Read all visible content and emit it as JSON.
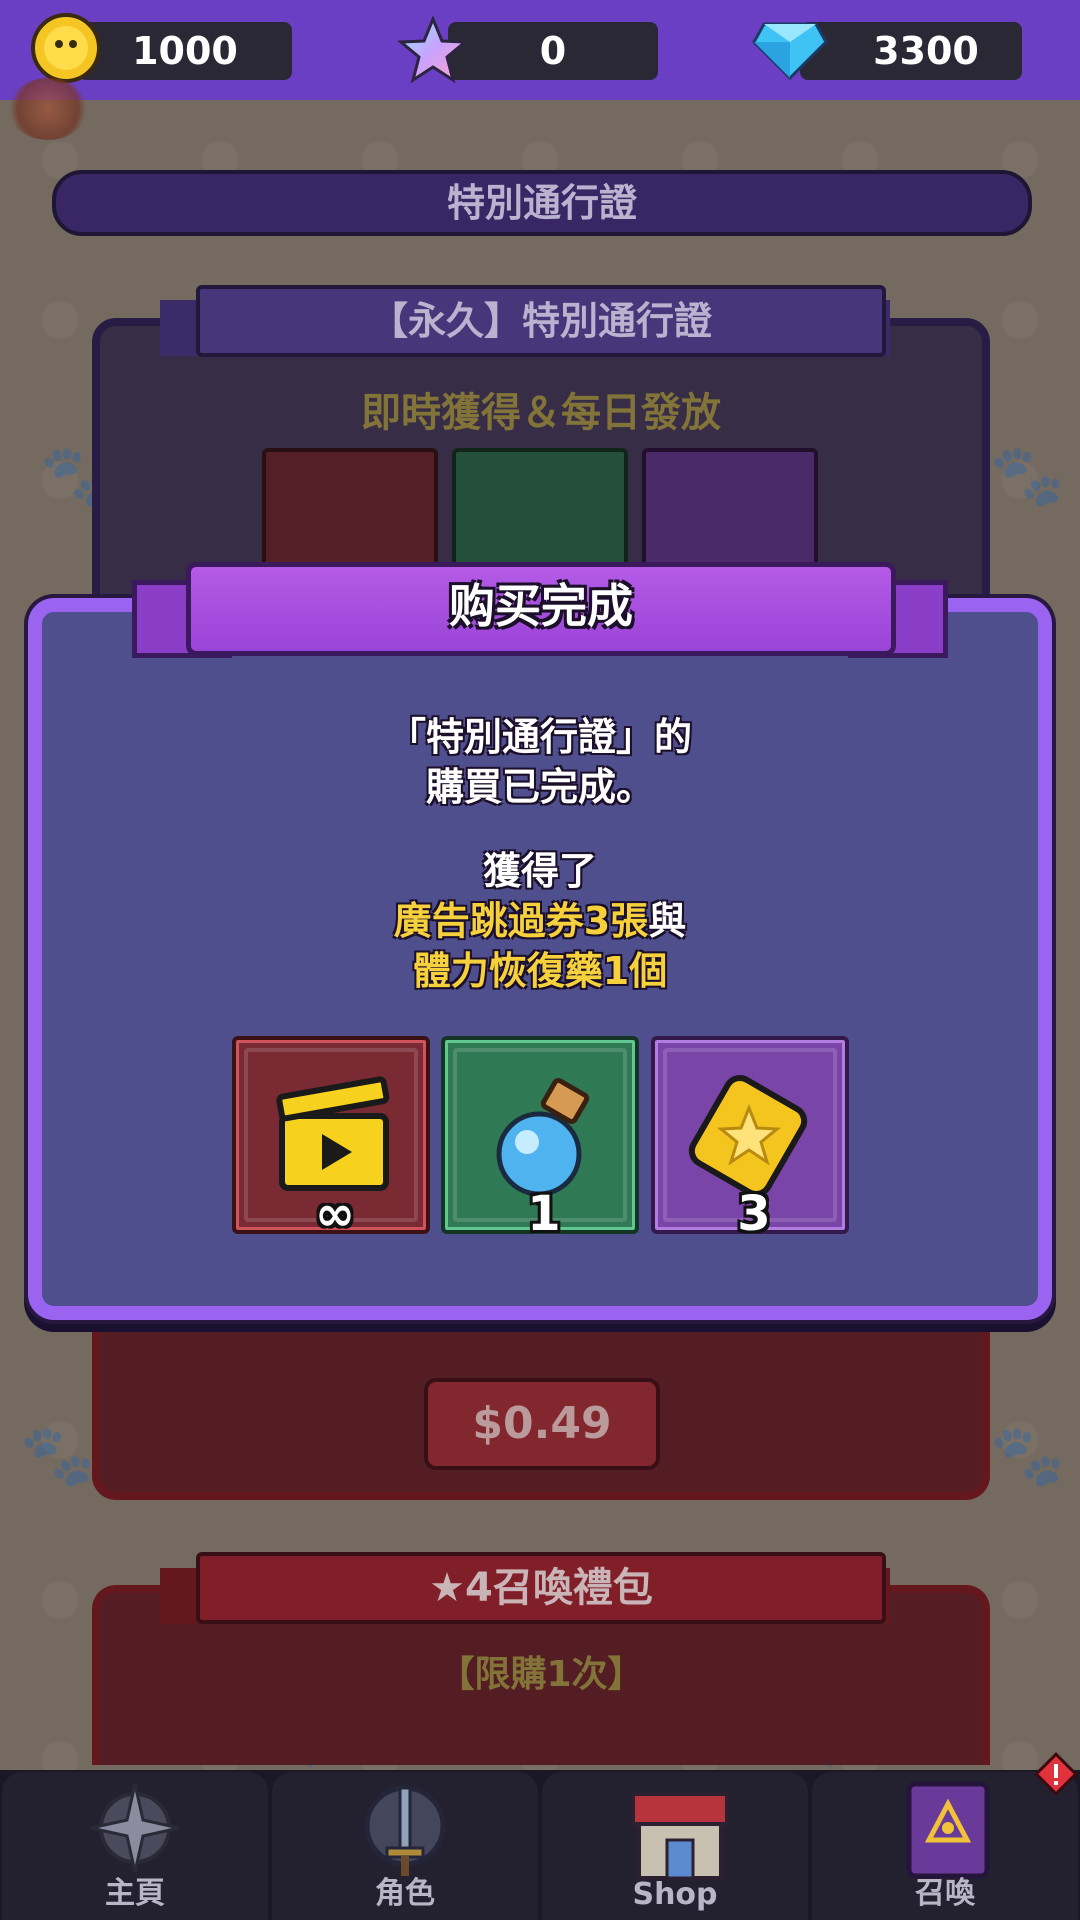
{
  "resources": {
    "coins": "1000",
    "stars": "0",
    "gems": "3300"
  },
  "shop": {
    "section_title": "特別通行證",
    "pass_card": {
      "title": "【永久】特別通行證",
      "subtitle": "即時獲得＆每日發放",
      "price": "$0.49"
    },
    "summon_card": {
      "title": "★4召喚禮包",
      "subtitle": "【限購1次】"
    }
  },
  "modal": {
    "title": "购买完成",
    "line1": "「特別通行證」的",
    "line2": "購買已完成。",
    "line3": "獲得了",
    "line4_highlight": "廣告跳過券3張",
    "line4_suffix": "與",
    "line5_highlight": "體力恢復藥1個",
    "rewards": [
      {
        "icon": "clapperboard-icon",
        "count": "∞",
        "color": "#7a2a33"
      },
      {
        "icon": "potion-icon",
        "count": "1",
        "color": "#2f7a55"
      },
      {
        "icon": "star-ticket-icon",
        "count": "3",
        "color": "#7a45a8"
      }
    ]
  },
  "nav": {
    "home": "主頁",
    "character": "角色",
    "shop": "Shop",
    "summon": "召喚"
  },
  "colors": {
    "topbar": "#6b3fc4",
    "modal_border": "#9a63f0",
    "modal_bg": "#4e4f8c",
    "highlight": "#f6d13b"
  }
}
